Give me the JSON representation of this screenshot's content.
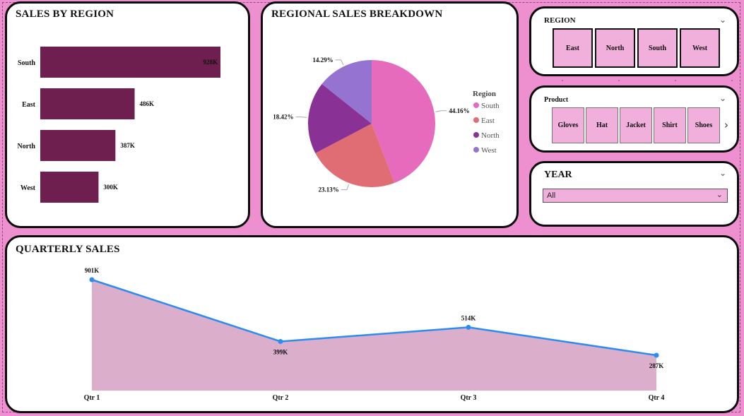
{
  "sales_by_region": {
    "title": "SALES BY REGION",
    "chart_data": {
      "type": "bar",
      "orientation": "horizontal",
      "categories": [
        "South",
        "East",
        "North",
        "West"
      ],
      "values": [
        928,
        486,
        387,
        300
      ],
      "value_labels": [
        "928K",
        "486K",
        "387K",
        "300K"
      ],
      "bar_color": "#6e1f4f"
    }
  },
  "regional_breakdown": {
    "title": "REGIONAL SALES BREAKDOWN",
    "legend_title": "Region",
    "chart_data": {
      "type": "pie",
      "labels": [
        "South",
        "East",
        "North",
        "West"
      ],
      "values": [
        44.16,
        23.13,
        18.42,
        14.29
      ],
      "value_labels": [
        "44.16%",
        "23.13%",
        "18.42%",
        "14.29%"
      ],
      "colors": [
        "#e66bbd",
        "#e06c74",
        "#8a3196",
        "#9573d0"
      ],
      "legend_position": "right"
    }
  },
  "region_slicer": {
    "title": "REGION",
    "tiles": [
      "East",
      "North",
      "South",
      "West"
    ]
  },
  "product_slicer": {
    "title": "Product",
    "tiles": [
      "Gloves",
      "Hat",
      "Jacket",
      "Shirt",
      "Shoes"
    ]
  },
  "year_slicer": {
    "title": "YEAR",
    "selected": "All"
  },
  "quarterly_sales": {
    "title": "QUARTERLY SALES",
    "chart_data": {
      "type": "area",
      "categories": [
        "Qtr 1",
        "Qtr 2",
        "Qtr 3",
        "Qtr 4"
      ],
      "values": [
        901,
        399,
        514,
        287
      ],
      "value_labels": [
        "901K",
        "399K",
        "514K",
        "287K"
      ],
      "line_color": "#2d8cf0",
      "fill_color": "#dbaecb"
    }
  }
}
